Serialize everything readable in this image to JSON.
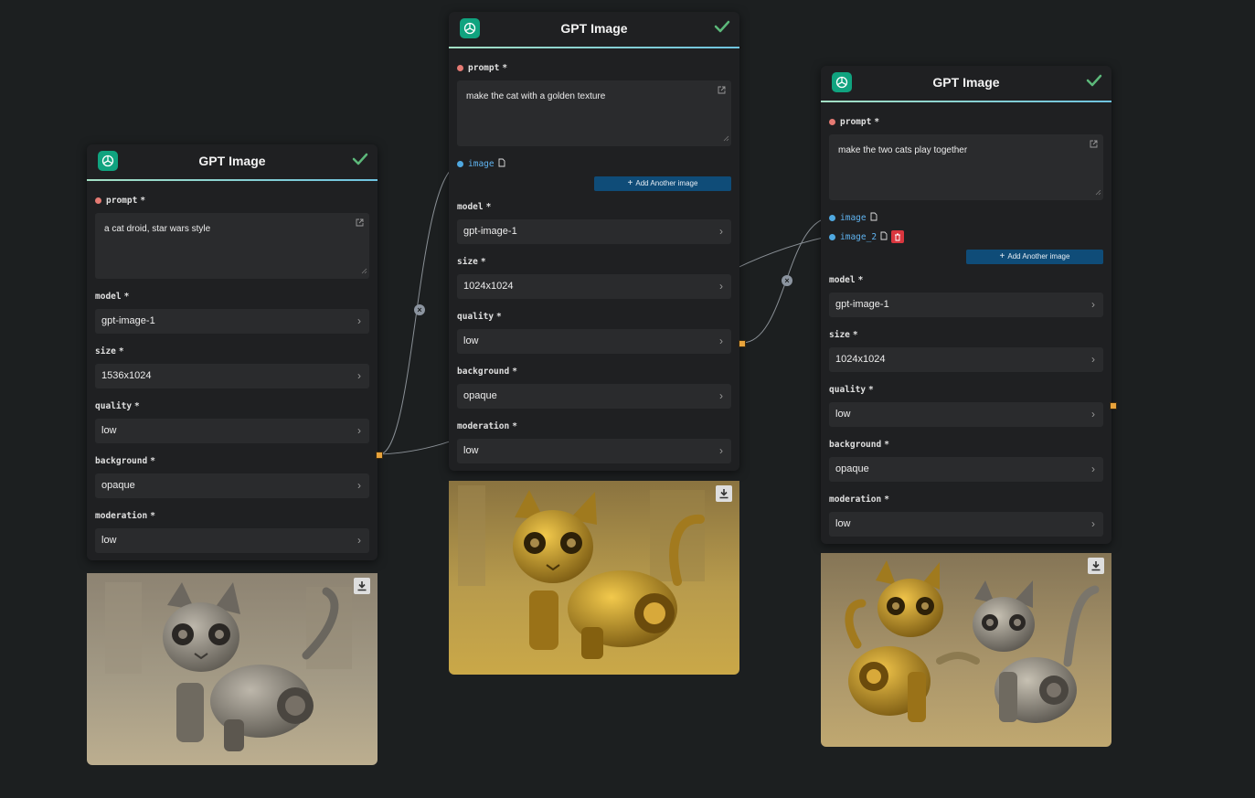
{
  "nodes": [
    {
      "title": "GPT Image",
      "prompt_label": "prompt",
      "prompt_value": "a cat droid, star wars style",
      "model_label": "model",
      "model_value": "gpt-image-1",
      "size_label": "size",
      "size_value": "1536x1024",
      "quality_label": "quality",
      "quality_value": "low",
      "background_label": "background",
      "background_value": "opaque",
      "moderation_label": "moderation",
      "moderation_value": "low"
    },
    {
      "title": "GPT Image",
      "prompt_label": "prompt",
      "prompt_value": "make the cat with a golden texture",
      "image_label": "image",
      "add_image_label": "Add Another image",
      "model_label": "model",
      "model_value": "gpt-image-1",
      "size_label": "size",
      "size_value": "1024x1024",
      "quality_label": "quality",
      "quality_value": "low",
      "background_label": "background",
      "background_value": "opaque",
      "moderation_label": "moderation",
      "moderation_value": "low"
    },
    {
      "title": "GPT Image",
      "prompt_label": "prompt",
      "prompt_value": "make the two cats play together",
      "image_label": "image",
      "image2_label": "image_2",
      "add_image_label": "Add Another image",
      "model_label": "model",
      "model_value": "gpt-image-1",
      "size_label": "size",
      "size_value": "1024x1024",
      "quality_label": "quality",
      "quality_value": "low",
      "background_label": "background",
      "background_value": "opaque",
      "moderation_label": "moderation",
      "moderation_value": "low"
    }
  ],
  "required_marker": "*",
  "colors": {
    "canvas": "#1c1f20",
    "node_bg": "#1f2022",
    "field_bg": "#2a2b2d",
    "accent_line": "#8ccbd9",
    "openai_green": "#10a37f",
    "check_green": "#5cb87a",
    "add_button": "#0f4c78",
    "delete_button": "#d9363e",
    "output_handle": "#e8a33b",
    "image_input_label": "#5fb3f0"
  },
  "icons": [
    "openai-logo-icon",
    "checkmark-icon",
    "external-link-icon",
    "file-icon",
    "trash-icon",
    "download-icon",
    "chevron-right-icon",
    "plus-icon",
    "disconnect-x-icon"
  ]
}
